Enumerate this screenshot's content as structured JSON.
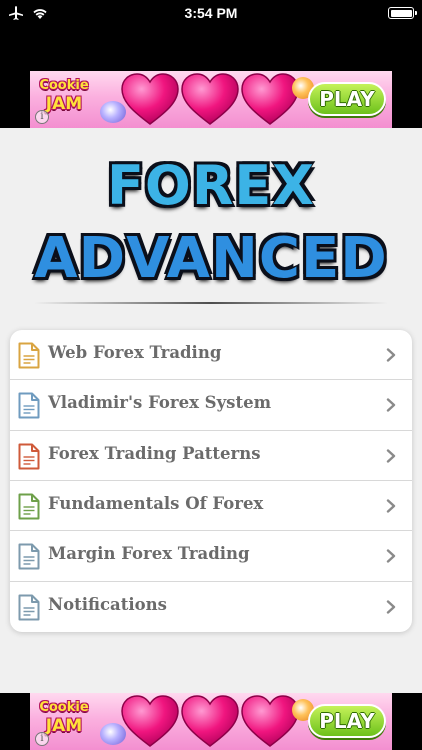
{
  "status_bar": {
    "time": "3:54 PM",
    "airplane_icon": "airplane-icon",
    "wifi_icon": "wifi-icon",
    "battery_icon": "battery-icon"
  },
  "ads": {
    "top": {
      "brand_line1": "Cookie",
      "brand_line2": "JAM",
      "cta": "PLAY",
      "info_glyph": "i"
    },
    "bottom": {
      "brand_line1": "Cookie",
      "brand_line2": "JAM",
      "cta": "PLAY",
      "info_glyph": "i"
    }
  },
  "hero": {
    "line1": "FOREX",
    "line2": "ADVANCED"
  },
  "menu": {
    "items": [
      {
        "label": "Web Forex Trading",
        "icon": "document-icon",
        "icon_color": "#d9a441"
      },
      {
        "label": "Vladimir's Forex System",
        "icon": "document-icon",
        "icon_color": "#6f9bbf"
      },
      {
        "label": "Forex Trading Patterns",
        "icon": "document-icon",
        "icon_color": "#cf5a3a"
      },
      {
        "label": "Fundamentals Of Forex",
        "icon": "document-icon",
        "icon_color": "#6ea04a"
      },
      {
        "label": "Margin Forex Trading",
        "icon": "document-icon",
        "icon_color": "#7d9aad"
      },
      {
        "label": "Notifications",
        "icon": "document-icon",
        "icon_color": "#7d9aad"
      }
    ]
  },
  "colors": {
    "title_light_blue": "#3cb3e6",
    "title_blue": "#2f8fe0",
    "menu_text": "#6b6b6b",
    "chevron": "#8a8a8a"
  }
}
